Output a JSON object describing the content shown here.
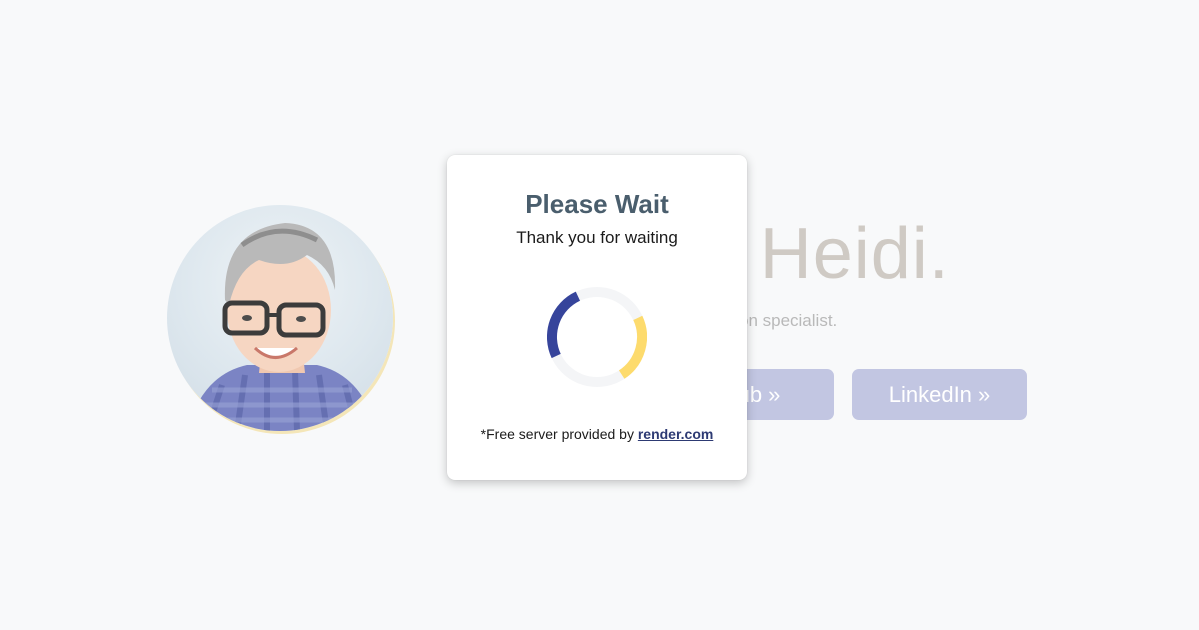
{
  "background": {
    "hero_title": "I'm Heidi.",
    "hero_subtitle": "A web developer and production specialist.",
    "buttons": {
      "github_label": "GitHub »",
      "linkedin_label": "LinkedIn »"
    },
    "avatar_description": "profile-photo"
  },
  "modal": {
    "title": "Please Wait",
    "subtitle": "Thank you for waiting",
    "footer_prefix": "*Free server provided by",
    "footer_link": "render.com"
  },
  "colors": {
    "page_background": "#f8f9fa",
    "modal_title": "#4a5e6d",
    "spinner_blue": "#36449b",
    "spinner_yellow": "#fddb6d",
    "spinner_track": "#f4f5f7",
    "button_faded": "#c2c6e2",
    "link": "#2d3a73"
  }
}
